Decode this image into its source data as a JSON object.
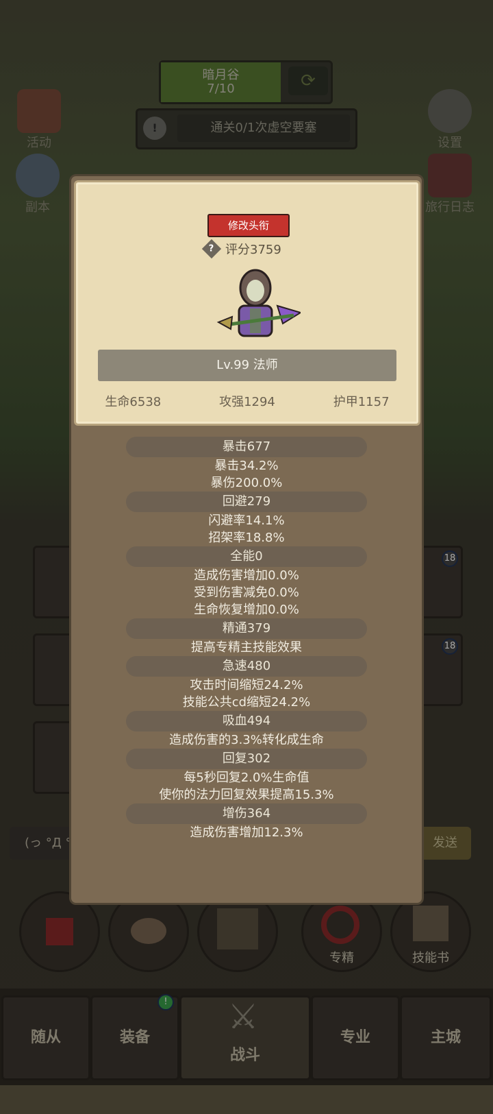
{
  "zone": {
    "name": "暗月谷",
    "progress": "7/10",
    "progress_fraction": 0.7
  },
  "quest": {
    "text": "通关0/1次虚空要塞"
  },
  "side_left": [
    {
      "label": "活动"
    },
    {
      "label": "副本"
    }
  ],
  "side_right": [
    {
      "label": "设置"
    },
    {
      "label": "旅行日志"
    }
  ],
  "modal": {
    "title_button": "修改头衔",
    "score": "评分3759",
    "level_class": "Lv.99 法师",
    "base_stats": [
      "生命6538",
      "攻强1294",
      "护甲1157"
    ],
    "sections": [
      {
        "head": "暴击677",
        "lines": [
          "暴击34.2%",
          "暴伤200.0%"
        ]
      },
      {
        "head": "回避279",
        "lines": [
          "闪避率14.1%",
          "招架率18.8%"
        ]
      },
      {
        "head": "全能0",
        "lines": [
          "造成伤害增加0.0%",
          "受到伤害减免0.0%",
          "生命恢复增加0.0%"
        ]
      },
      {
        "head": "精通379",
        "lines": [
          "提高专精主技能效果"
        ]
      },
      {
        "head": "急速480",
        "lines": [
          "攻击时间缩短24.2%",
          "技能公共cd缩短24.2%"
        ]
      },
      {
        "head": "吸血494",
        "lines": [
          "造成伤害的3.3%转化成生命"
        ]
      },
      {
        "head": "回复302",
        "lines": [
          "每5秒回复2.0%生命值",
          "使你的法力回复效果提高15.3%"
        ]
      },
      {
        "head": "增伤364",
        "lines": [
          "造成伤害增加12.3%"
        ]
      }
    ]
  },
  "chat": {
    "placeholder": "(っ °Д °",
    "send": "发送"
  },
  "item_badges": [
    "18",
    "18"
  ],
  "actions": [
    {
      "label": ""
    },
    {
      "label": ""
    },
    {
      "label": ""
    },
    {
      "label": "专精"
    },
    {
      "label": "技能书"
    }
  ],
  "tabs": [
    "随从",
    "装备",
    "战斗",
    "专业",
    "主城"
  ],
  "equip_badge": "!"
}
